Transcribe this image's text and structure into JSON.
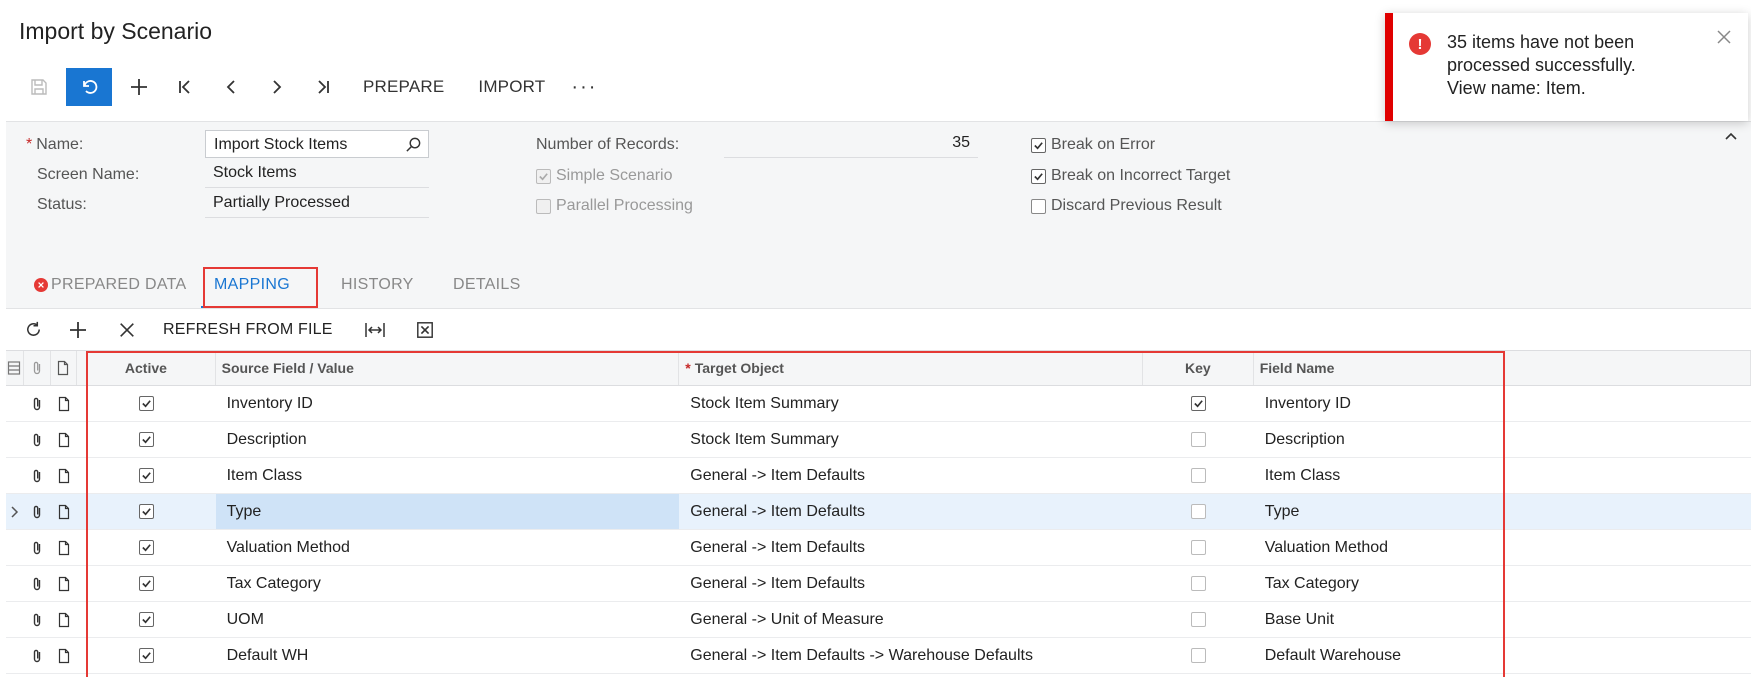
{
  "page": {
    "title": "Import by Scenario"
  },
  "toolbar": {
    "prepare_label": "PREPARE",
    "import_label": "IMPORT",
    "more_label": "···"
  },
  "form": {
    "name_label": "Name:",
    "name_value": "Import Stock Items",
    "screen_name_label": "Screen Name:",
    "screen_name_value": "Stock Items",
    "status_label": "Status:",
    "status_value": "Partially Processed",
    "records_label": "Number of Records:",
    "records_value": "35",
    "simple_scenario_label": "Simple Scenario",
    "parallel_label": "Parallel Processing",
    "break_error_label": "Break on Error",
    "break_target_label": "Break on Incorrect Target",
    "discard_label": "Discard Previous Result"
  },
  "tabs": {
    "prepared": "PREPARED DATA",
    "mapping": "MAPPING",
    "history": "HISTORY",
    "details": "DETAILS"
  },
  "grid_toolbar": {
    "refresh_label": "REFRESH FROM FILE"
  },
  "grid": {
    "headers": {
      "active": "Active",
      "source": "Source Field / Value",
      "target": "Target Object",
      "key": "Key",
      "field": "Field Name"
    },
    "rows": [
      {
        "active": true,
        "source": "Inventory ID",
        "target": "Stock Item Summary",
        "key": true,
        "field": "Inventory ID"
      },
      {
        "active": true,
        "source": "Description",
        "target": "Stock Item Summary",
        "key": false,
        "field": "Description"
      },
      {
        "active": true,
        "source": "Item Class",
        "target": "General -> Item Defaults",
        "key": false,
        "field": "Item Class"
      },
      {
        "active": true,
        "source": "Type",
        "target": "General -> Item Defaults",
        "key": false,
        "field": "Type"
      },
      {
        "active": true,
        "source": "Valuation Method",
        "target": "General -> Item Defaults",
        "key": false,
        "field": "Valuation Method"
      },
      {
        "active": true,
        "source": "Tax Category",
        "target": "General -> Item Defaults",
        "key": false,
        "field": "Tax Category"
      },
      {
        "active": true,
        "source": "UOM",
        "target": "General -> Unit of Measure",
        "key": false,
        "field": "Base Unit"
      },
      {
        "active": true,
        "source": "Default WH",
        "target": "General -> Item Defaults -> Warehouse Defaults",
        "key": false,
        "field": "Default Warehouse"
      }
    ]
  },
  "toast": {
    "line1": "35 items have not been",
    "line2": "processed successfully.",
    "line3": "View name: Item."
  },
  "colors": {
    "accent": "#1976d2",
    "error": "#e53935",
    "toast_bar": "#e00000"
  }
}
